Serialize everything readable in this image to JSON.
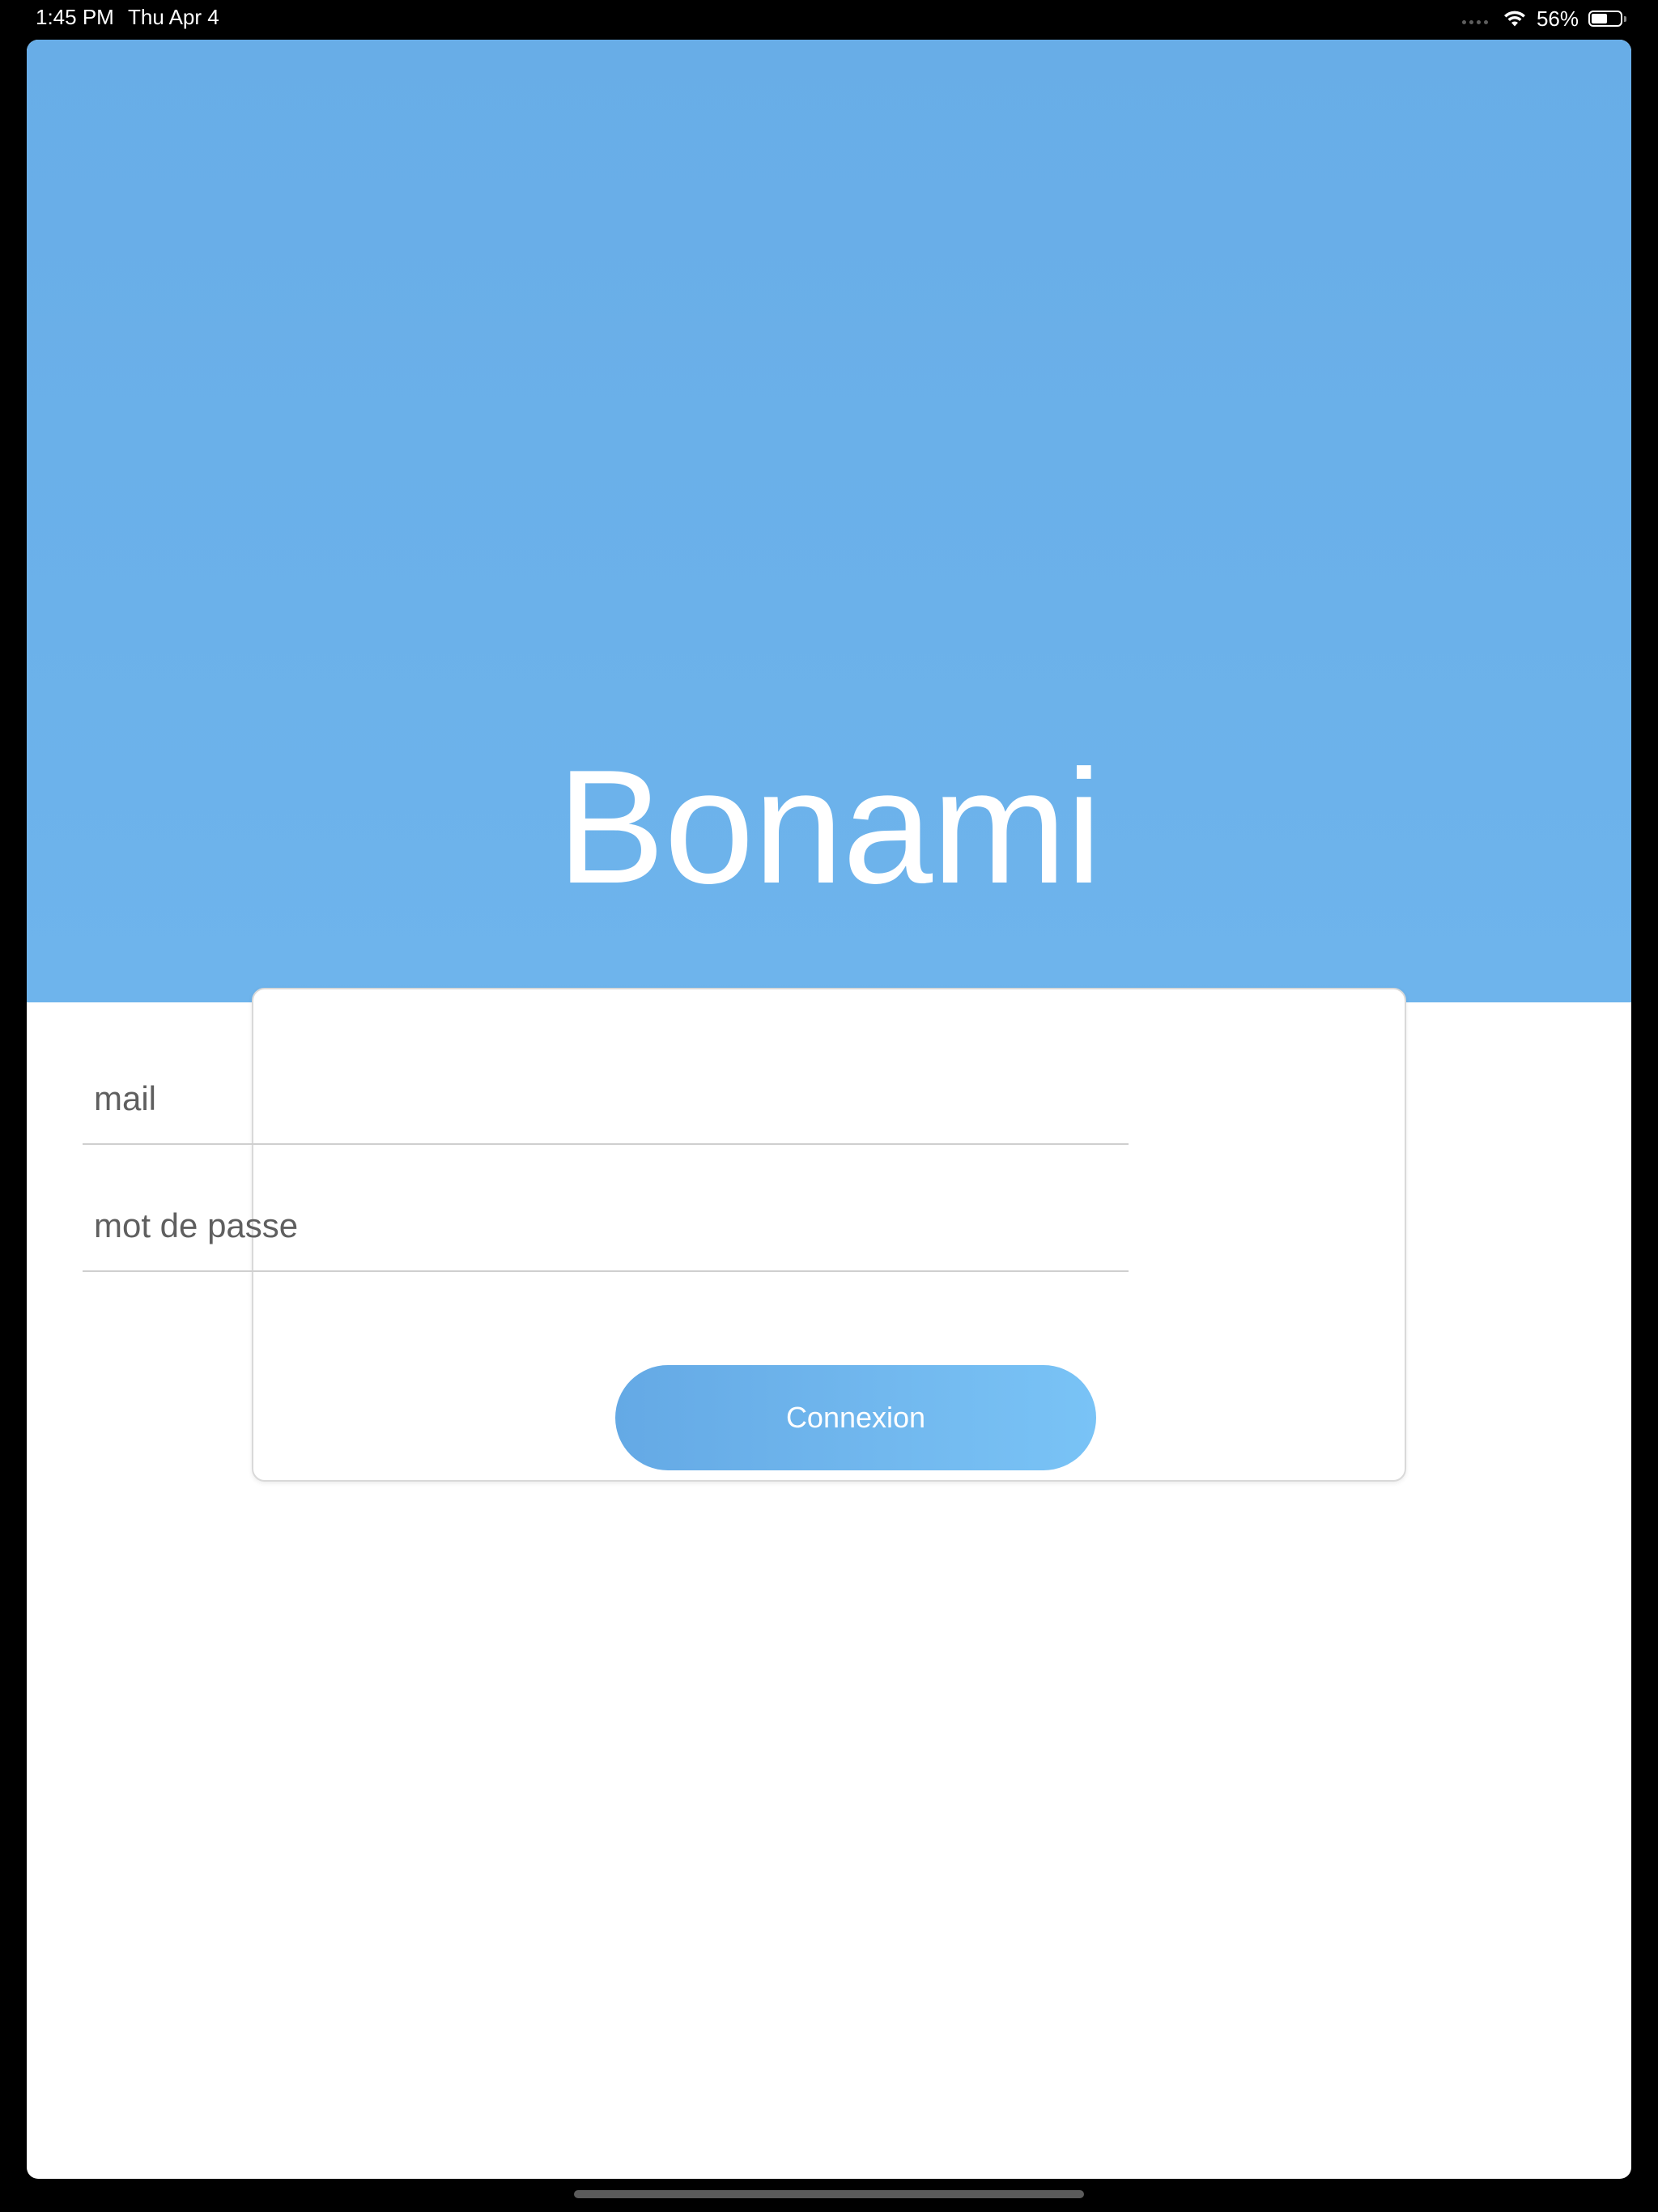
{
  "status_bar": {
    "time": "1:45 PM",
    "date": "Thu Apr 4",
    "battery_percent": "56%",
    "battery_level": 0.56,
    "icons": [
      "signal-dots-icon",
      "wifi-icon",
      "battery-icon"
    ]
  },
  "app": {
    "title": "Bonami"
  },
  "login": {
    "mail_placeholder": "mail",
    "mail_value": "",
    "password_placeholder": "mot de passe",
    "password_value": "",
    "submit_label": "Connexion"
  },
  "colors": {
    "header_blue": "#6bb1ea",
    "button_gradient_start": "#64a9e5",
    "button_gradient_end": "#79c3f6",
    "background": "#ffffff"
  }
}
